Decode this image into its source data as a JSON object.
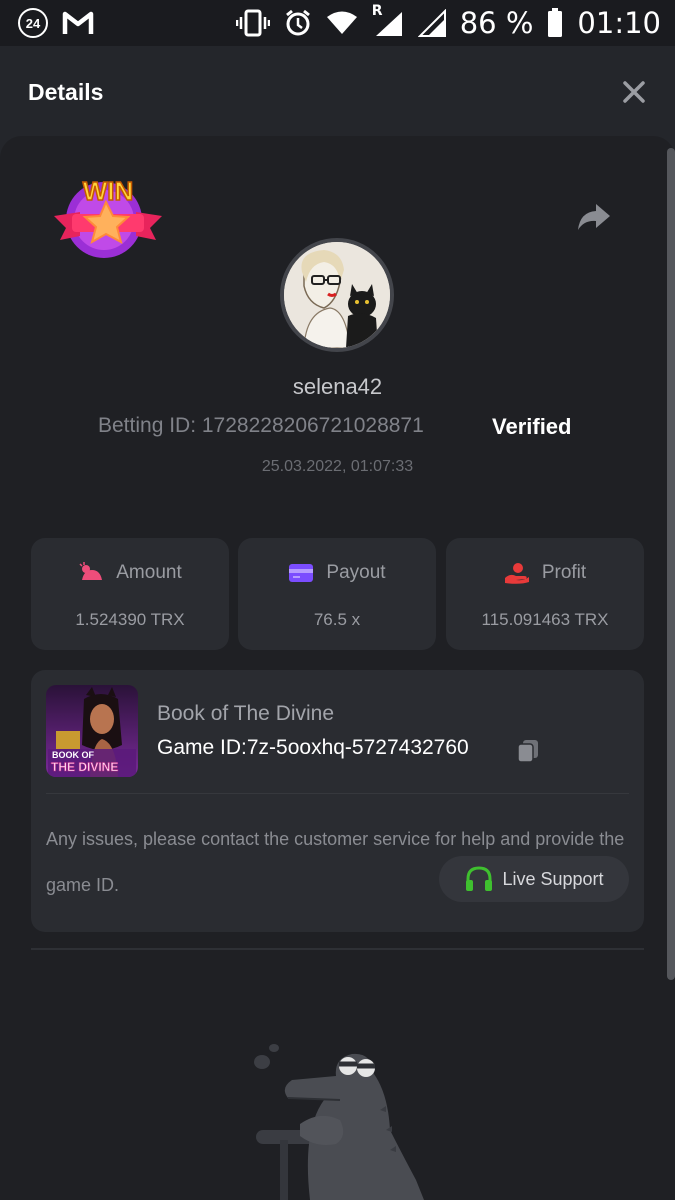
{
  "status_bar": {
    "notification_badge": "24",
    "battery_percent": "86 %",
    "time": "01:10",
    "roaming": "R"
  },
  "header": {
    "title": "Details"
  },
  "bet": {
    "badge": "WIN",
    "username": "selena42",
    "betting_id": "Betting ID: 1728228206721028871",
    "verified_label": "Verified",
    "timestamp": "25.03.2022, 01:07:33"
  },
  "stats": [
    {
      "label": "Amount",
      "value": "1.524390 TRX",
      "icon": "coins-icon",
      "color": "#ee4d7a"
    },
    {
      "label": "Payout",
      "value": "76.5 x",
      "icon": "wallet-icon",
      "color": "#7b4dff"
    },
    {
      "label": "Profit",
      "value": "115.091463 TRX",
      "icon": "hand-coin-icon",
      "color": "#e83a3a"
    }
  ],
  "game": {
    "name": "Book of The Divine",
    "id_label": "Game ID:",
    "id_value": "7z-5ooxhq-5727432760",
    "thumb_text_top": "BOOK OF",
    "thumb_text_bottom": "THE DIVINE",
    "issue_text": "Any issues, please contact the customer service for help and provide the game ID.",
    "live_support_label": "Live Support"
  },
  "colors": {
    "background": "#24262b",
    "card": "#1f2024",
    "tile": "#2a2c31",
    "support_icon": "#3fc02f"
  }
}
